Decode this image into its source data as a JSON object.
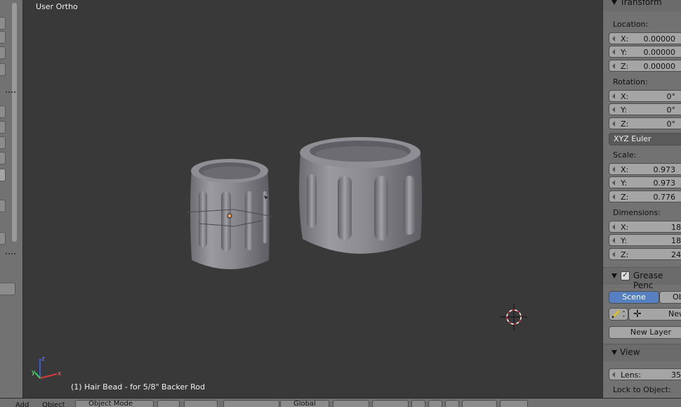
{
  "viewport": {
    "title": "User Ortho",
    "status": "(1) Hair Bead - for 5/8\" Backer Rod"
  },
  "transform": {
    "header": "Transform",
    "location_label": "Location:",
    "location": [
      {
        "axis": "X:",
        "value": "0.00000"
      },
      {
        "axis": "Y:",
        "value": "0.00000"
      },
      {
        "axis": "Z:",
        "value": "0.00000"
      }
    ],
    "rotation_label": "Rotation:",
    "rotation": [
      {
        "axis": "X:",
        "value": "0°"
      },
      {
        "axis": "Y:",
        "value": "0°"
      },
      {
        "axis": "Z:",
        "value": "0°"
      }
    ],
    "rotation_mode": "XYZ Euler",
    "scale_label": "Scale:",
    "scale": [
      {
        "axis": "X:",
        "value": "0.973"
      },
      {
        "axis": "Y:",
        "value": "0.973"
      },
      {
        "axis": "Z:",
        "value": "0.776"
      }
    ],
    "dimensions_label": "Dimensions:",
    "dimensions": [
      {
        "axis": "X:",
        "value": "18"
      },
      {
        "axis": "Y:",
        "value": "18"
      },
      {
        "axis": "Z:",
        "value": "24"
      }
    ]
  },
  "grease_pencil": {
    "header": "Grease Penc",
    "tab_scene": "Scene",
    "tab_object": "Ob",
    "new_label": "New",
    "new_layer_label": "New Layer"
  },
  "view": {
    "header": "View",
    "lens_label": "Lens:",
    "lens_value": "35",
    "lock_label": "Lock to Object:"
  },
  "bottom_bar": {
    "add": "Add",
    "object": "Object",
    "mode": "Object Mode",
    "orientation": "Global"
  },
  "colors": {
    "accent": "#5680c2",
    "viewport_bg": "#393939",
    "panel_bg": "#727272"
  }
}
